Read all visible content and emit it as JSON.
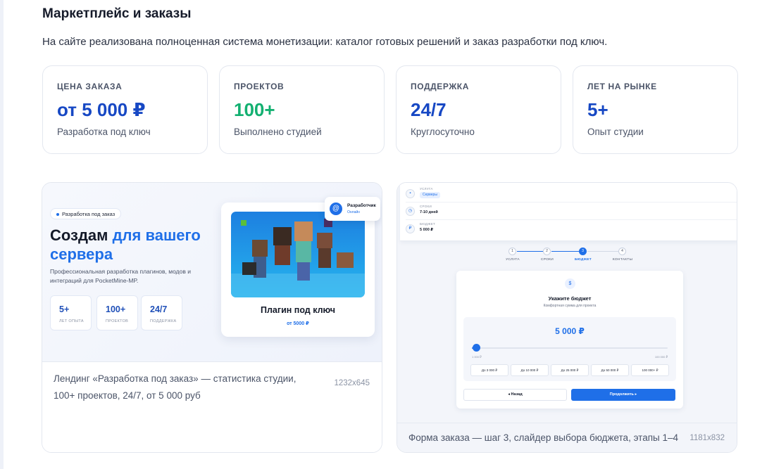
{
  "section": {
    "title": "Маркетплейс и заказы",
    "description": "На сайте реализована полноценная система монетизации: каталог готовых решений и заказ разработки под ключ."
  },
  "stats": [
    {
      "label": "ЦЕНА ЗАКАЗА",
      "value": "от 5 000 ₽",
      "sub": "Разработка под ключ",
      "color": "#1748c4"
    },
    {
      "label": "ПРОЕКТОВ",
      "value": "100+",
      "sub": "Выполнено студией",
      "color": "#13b071"
    },
    {
      "label": "ПОДДЕРЖКА",
      "value": "24/7",
      "sub": "Круглосуточно",
      "color": "#1748c4"
    },
    {
      "label": "ЛЕТ НА РЫНКЕ",
      "value": "5+",
      "sub": "Опыт студии",
      "color": "#1748c4"
    }
  ],
  "screenshots": [
    {
      "caption": "Лендинг «Разработка под заказ» — статистика студии, 100+ проектов, 24/7, от 5 000 руб",
      "dimensions": "1232x645",
      "landing": {
        "pill": "Разработка под заказ",
        "heading_plain": "Создам",
        "heading_accent": "для вашего сервера",
        "paragraph": "Профессиональная разработка плагинов, модов и интеграций для PocketMine-MP.",
        "stats": [
          {
            "value": "5+",
            "label": "ЛЕТ ОПЫТА"
          },
          {
            "value": "100+",
            "label": "ПРОЕКТОВ"
          },
          {
            "value": "24/7",
            "label": "ПОДДЕРЖКА"
          }
        ],
        "product_title": "Плагин под ключ",
        "product_price": "от 5000 ₽",
        "dev_name": "Разработчик",
        "dev_status": "Онлайн"
      }
    },
    {
      "caption": "Форма заказа — шаг 3, слайдер выбора бюджета, этапы 1–4",
      "dimensions": "1181x832",
      "form": {
        "summary": [
          {
            "label": "УСЛУГА",
            "value": "Серверы",
            "icon": "server-icon",
            "icon_char": "▪"
          },
          {
            "label": "СРОКИ",
            "value": "7-10 дней",
            "icon": "clock-icon",
            "icon_char": "◷"
          },
          {
            "label": "БЮДЖЕТ",
            "value": "5 000 ₽",
            "icon": "ruble-icon",
            "icon_char": "₽"
          }
        ],
        "steps": [
          {
            "num": "1",
            "label": "УСЛУГА"
          },
          {
            "num": "2",
            "label": "СРОКИ"
          },
          {
            "num": "3",
            "label": "БЮДЖЕТ"
          },
          {
            "num": "4",
            "label": "КОНТАКТЫ"
          }
        ],
        "active_step": 3,
        "title": "Укажите бюджет",
        "subtitle": "Комфортная сумма для проекта",
        "budget_value": "5 000 ₽",
        "slider_fraction": 0.0,
        "min_label": "1 000 ₽",
        "max_label": "100 000 ₽",
        "presets": [
          "До 3 000 ₽",
          "До 10 000 ₽",
          "До 25 000 ₽",
          "До 50 000 ₽",
          "100 000+ ₽"
        ],
        "back_label": "Назад",
        "next_label": "Продолжить"
      }
    }
  ],
  "colors": {
    "accent": "#1f6fe8",
    "green": "#13b071",
    "dark_blue": "#1748c4"
  }
}
